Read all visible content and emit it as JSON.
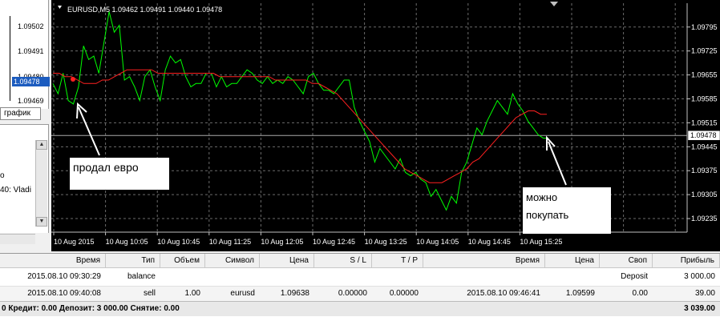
{
  "mini_chart": {
    "price_labels": [
      "1.09502",
      "1.09491",
      "1.09480",
      "1.09469"
    ],
    "current_price": "1.09478",
    "tab_label": "график"
  },
  "navigator": {
    "lines": [
      "о",
      "40: Vladi"
    ]
  },
  "chart": {
    "header": "EURUSD,M5  1.09462 1.09491 1.09440 1.09478",
    "background": "#000000",
    "grid_color": "#6b6b6b",
    "price_color": "#00ff00",
    "ma_color": "#ff2020",
    "current_price": "1.09478",
    "price_labels": [
      "1.09795",
      "1.09725",
      "1.09655",
      "1.09585",
      "1.09515",
      "1.09445",
      "1.09375",
      "1.09305",
      "1.09235"
    ],
    "time_labels": [
      "10 Aug 2015",
      "10 Aug 10:05",
      "10 Aug 10:45",
      "10 Aug 11:25",
      "10 Aug 12:05",
      "10 Aug 12:45",
      "10 Aug 13:25",
      "10 Aug 14:05",
      "10 Aug 14:45",
      "10 Aug 15:25"
    ],
    "annotations": {
      "sold": "продал евро",
      "buy_line1": "можно",
      "buy_line2": "покупать"
    }
  },
  "chart_data": {
    "type": "line",
    "title": "EURUSD,M5  1.09462 1.09491 1.09440 1.09478",
    "xlabel": "",
    "ylabel": "",
    "ylim": [
      1.092,
      1.0986
    ],
    "x_ticks": [
      "10 Aug 2015",
      "10 Aug 10:05",
      "10 Aug 10:45",
      "10 Aug 11:25",
      "10 Aug 12:05",
      "10 Aug 12:45",
      "10 Aug 13:25",
      "10 Aug 14:05",
      "10 Aug 14:45",
      "10 Aug 15:25"
    ],
    "y_ticks": [
      1.09795,
      1.09725,
      1.09655,
      1.09585,
      1.09515,
      1.09445,
      1.09375,
      1.09305,
      1.09235
    ],
    "series": [
      {
        "color": "#00ff00",
        "values": [
          1.0963,
          1.096,
          1.0966,
          1.0958,
          1.0957,
          1.0962,
          1.0974,
          1.097,
          1.0971,
          1.0966,
          1.0975,
          1.0984,
          1.0978,
          1.098,
          1.0964,
          1.0965,
          1.0962,
          1.0958,
          1.0965,
          1.0967,
          1.0962,
          1.0958,
          1.0967,
          1.0971,
          1.0969,
          1.097,
          1.0965,
          1.0962,
          1.0963,
          1.0963,
          1.0966,
          1.0966,
          1.0962,
          1.0965,
          1.0962,
          1.0963,
          1.0963,
          1.0965,
          1.0967,
          1.0966,
          1.0964,
          1.0963,
          1.0965,
          1.0963,
          1.0964,
          1.0963,
          1.0965,
          1.0964,
          1.0962,
          1.096,
          1.0965,
          1.0966,
          1.0963,
          1.0961,
          1.0961,
          1.096,
          1.0962,
          1.0964,
          1.0964,
          1.0956,
          1.0952,
          1.0949,
          1.0946,
          1.094,
          1.0944,
          1.0942,
          1.094,
          1.0938,
          1.0941,
          1.0937,
          1.0936,
          1.0937,
          1.0935,
          1.0934,
          1.093,
          1.0932,
          1.0929,
          1.0926,
          1.093,
          1.0928,
          1.0937,
          1.094,
          1.0945,
          1.095,
          1.0948,
          1.0952,
          1.0955,
          1.0958,
          1.0956,
          1.0954,
          1.096,
          1.0957,
          1.0955,
          1.0952,
          1.095,
          1.0948,
          1.0947,
          1.0947
        ]
      },
      {
        "color": "#ff2020",
        "values": [
          1.0966,
          1.0966,
          1.0965,
          1.0965,
          1.0964,
          1.0963,
          1.0963,
          1.0963,
          1.0964,
          1.0964,
          1.0965,
          1.0966,
          1.0967,
          1.0967,
          1.0967,
          1.0967,
          1.0967,
          1.0966,
          1.0966,
          1.0966,
          1.0966,
          1.0966,
          1.0966,
          1.0966,
          1.0966,
          1.0966,
          1.0966,
          1.0965,
          1.0965,
          1.0965,
          1.0965,
          1.0965,
          1.0965,
          1.0965,
          1.0965,
          1.0965,
          1.0964,
          1.0964,
          1.0964,
          1.0964,
          1.0964,
          1.0964,
          1.0963,
          1.0963,
          1.0962,
          1.0961,
          1.096,
          1.0958,
          1.0956,
          1.0954,
          1.0952,
          1.095,
          1.0948,
          1.0946,
          1.0944,
          1.0942,
          1.094,
          1.0938,
          1.0937,
          1.0936,
          1.0935,
          1.0934,
          1.0934,
          1.0934,
          1.0935,
          1.0936,
          1.0937,
          1.0938,
          1.094,
          1.0941,
          1.0943,
          1.0945,
          1.0947,
          1.0949,
          1.0951,
          1.0953,
          1.0954,
          1.0955,
          1.0955,
          1.0954,
          1.0954
        ]
      }
    ]
  },
  "terminal": {
    "headers": [
      "Время",
      "Тип",
      "Объем",
      "Символ",
      "Цена",
      "S / L",
      "T / P",
      "Время",
      "Цена",
      "Своп",
      "Прибыль"
    ],
    "rows": [
      {
        "time": "2015.08.10 09:30:29",
        "type": "balance",
        "volume": "",
        "symbol": "",
        "price": "",
        "sl": "",
        "tp": "",
        "close_time": "",
        "close_price": "",
        "swap": "Deposit",
        "profit": "3 000.00"
      },
      {
        "time": "2015.08.10 09:40:08",
        "type": "sell",
        "volume": "1.00",
        "symbol": "eurusd",
        "price": "1.09638",
        "sl": "0.00000",
        "tp": "0.00000",
        "close_time": "2015.08.10 09:46:41",
        "close_price": "1.09599",
        "swap": "0.00",
        "profit": "39.00"
      }
    ],
    "summary": "0  Кредит: 0.00  Депозит: 3 000.00  Снятие: 0.00",
    "summary_total": "3 039.00"
  }
}
